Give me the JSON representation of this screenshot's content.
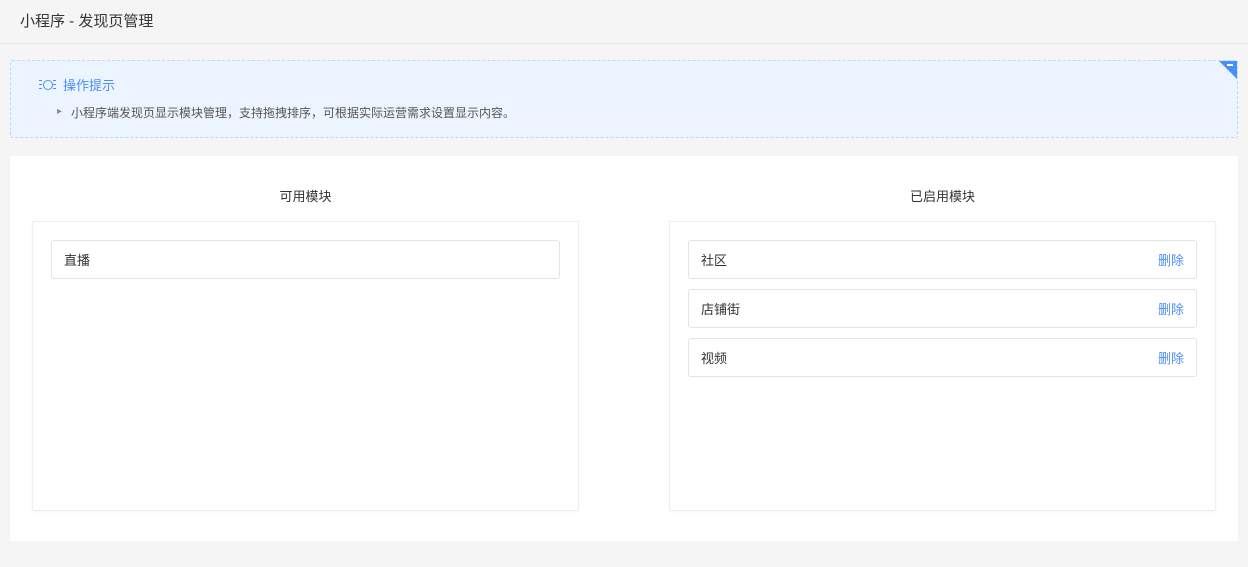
{
  "header": {
    "title": "小程序 - 发现页管理"
  },
  "tip": {
    "title": "操作提示",
    "items": [
      "小程序端发现页显示模块管理，支持拖拽排序，可根据实际运营需求设置显示内容。"
    ]
  },
  "columns": {
    "available": {
      "title": "可用模块",
      "modules": [
        {
          "label": "直播"
        }
      ]
    },
    "enabled": {
      "title": "已启用模块",
      "delete_label": "删除",
      "modules": [
        {
          "label": "社区"
        },
        {
          "label": "店铺街"
        },
        {
          "label": "视频"
        }
      ]
    }
  }
}
